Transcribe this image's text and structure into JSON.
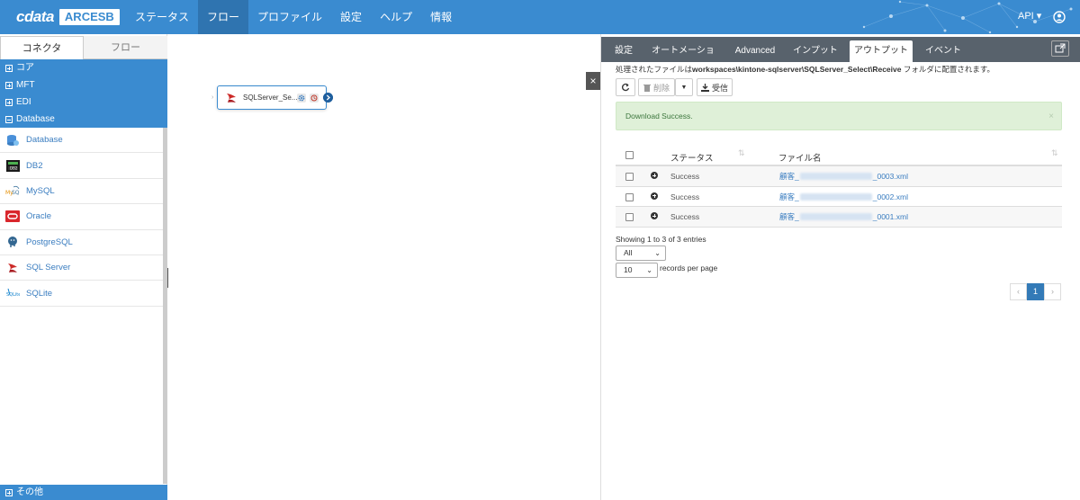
{
  "brand": {
    "cdata": "cdata",
    "arcesb": "ARCESB"
  },
  "nav": {
    "items": [
      {
        "label": "ステータス",
        "active": false
      },
      {
        "label": "フロー",
        "active": true
      },
      {
        "label": "プロファイル",
        "active": false
      },
      {
        "label": "設定",
        "active": false
      },
      {
        "label": "ヘルプ",
        "active": false
      },
      {
        "label": "情報",
        "active": false
      }
    ],
    "api_label": "API ▾",
    "user_icon": "user-circle-icon"
  },
  "sidebar": {
    "tabs": [
      "コネクタ",
      "フロー"
    ],
    "categories": [
      {
        "label": "コア",
        "expanded": false
      },
      {
        "label": "MFT",
        "expanded": false
      },
      {
        "label": "EDI",
        "expanded": false
      },
      {
        "label": "Database",
        "expanded": true
      }
    ],
    "connectors": [
      {
        "label": "Database",
        "icon": "database-icon"
      },
      {
        "label": "DB2",
        "icon": "ibm-db2-icon"
      },
      {
        "label": "MySQL",
        "icon": "mysql-icon"
      },
      {
        "label": "Oracle",
        "icon": "oracle-icon"
      },
      {
        "label": "PostgreSQL",
        "icon": "postgresql-icon"
      },
      {
        "label": "SQL Server",
        "icon": "sqlserver-icon"
      },
      {
        "label": "SQLite",
        "icon": "sqlite-icon"
      }
    ],
    "footer": "その他"
  },
  "canvas": {
    "node_label": "SQLServer_Se..."
  },
  "panel": {
    "tabs": [
      "設定",
      "オートメーション",
      "Advanced",
      "インプット",
      "アウトプット",
      "イベント"
    ],
    "active_tab": "アウトプット",
    "path_prefix": "処理されたファイルは",
    "path": "workspaces\\kintone-sqlserver\\SQLServer_Select\\Receive",
    "path_suffix": " フォルダに配置されます。",
    "toolbar": {
      "delete_label": "削除",
      "receive_label": "受信"
    },
    "alert": {
      "text": "Download Success.",
      "close": "×"
    },
    "table": {
      "headers": {
        "status": "ステータス",
        "filename": "ファイル名"
      },
      "rows": [
        {
          "status": "Success",
          "file_prefix": "顧客_",
          "file_suffix": "_0003.xml"
        },
        {
          "status": "Success",
          "file_prefix": "顧客_",
          "file_suffix": "_0002.xml"
        },
        {
          "status": "Success",
          "file_prefix": "顧客_",
          "file_suffix": "_0001.xml"
        }
      ]
    },
    "showing": "Showing 1 to 3 of 3 entries",
    "filter_select": "All",
    "page_size_select": "10",
    "records_per_page": "records per page",
    "pagination": {
      "prev": "‹",
      "current": "1",
      "next": "›"
    }
  }
}
